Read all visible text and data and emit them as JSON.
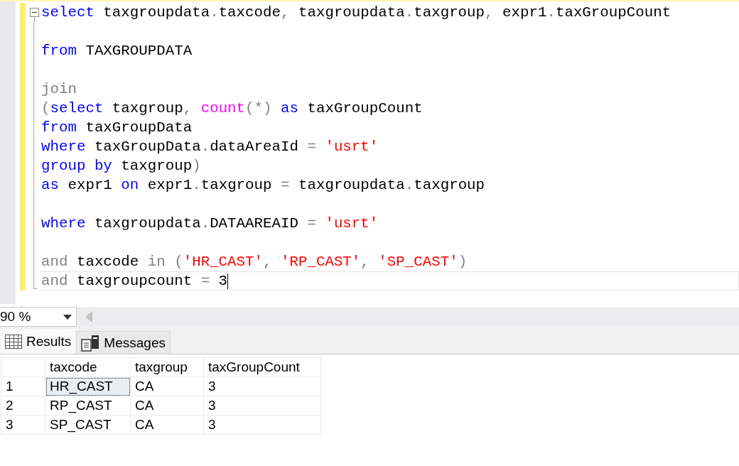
{
  "editor": {
    "lines": [
      {
        "kind": "fold_start",
        "current": false,
        "tokens": [
          {
            "kind": "keyword",
            "text": "select"
          },
          {
            "kind": "plain",
            "text": " taxgroupdata"
          },
          {
            "kind": "operator",
            "text": "."
          },
          {
            "kind": "plain",
            "text": "taxcode"
          },
          {
            "kind": "operator",
            "text": ","
          },
          {
            "kind": "plain",
            "text": " taxgroupdata"
          },
          {
            "kind": "operator",
            "text": "."
          },
          {
            "kind": "plain",
            "text": "taxgroup"
          },
          {
            "kind": "operator",
            "text": ","
          },
          {
            "kind": "plain",
            "text": " expr1"
          },
          {
            "kind": "operator",
            "text": "."
          },
          {
            "kind": "plain",
            "text": "taxGroupCount"
          }
        ]
      },
      {
        "kind": "blank"
      },
      {
        "kind": "code",
        "current": false,
        "tokens": [
          {
            "kind": "keyword",
            "text": "from"
          },
          {
            "kind": "plain",
            "text": " TAXGROUPDATA"
          }
        ]
      },
      {
        "kind": "blank"
      },
      {
        "kind": "code",
        "current": false,
        "tokens": [
          {
            "kind": "operator",
            "text": "join"
          }
        ]
      },
      {
        "kind": "code",
        "current": false,
        "tokens": [
          {
            "kind": "operator",
            "text": "("
          },
          {
            "kind": "keyword",
            "text": "select"
          },
          {
            "kind": "plain",
            "text": " taxgroup"
          },
          {
            "kind": "operator",
            "text": ","
          },
          {
            "kind": "function",
            "text": " count"
          },
          {
            "kind": "operator",
            "text": "(*)"
          },
          {
            "kind": "keyword",
            "text": " as"
          },
          {
            "kind": "plain",
            "text": " taxGroupCount"
          }
        ]
      },
      {
        "kind": "code",
        "current": false,
        "tokens": [
          {
            "kind": "keyword",
            "text": "from"
          },
          {
            "kind": "plain",
            "text": " taxGroupData"
          }
        ]
      },
      {
        "kind": "code",
        "current": false,
        "tokens": [
          {
            "kind": "keyword",
            "text": "where"
          },
          {
            "kind": "plain",
            "text": " taxGroupData"
          },
          {
            "kind": "operator",
            "text": "."
          },
          {
            "kind": "plain",
            "text": "dataAreaId "
          },
          {
            "kind": "operator",
            "text": "="
          },
          {
            "kind": "string",
            "text": " 'usrt'"
          }
        ]
      },
      {
        "kind": "code",
        "current": false,
        "tokens": [
          {
            "kind": "keyword",
            "text": "group by"
          },
          {
            "kind": "plain",
            "text": " taxgroup"
          },
          {
            "kind": "operator",
            "text": ")"
          }
        ]
      },
      {
        "kind": "code",
        "current": false,
        "tokens": [
          {
            "kind": "keyword",
            "text": "as"
          },
          {
            "kind": "plain",
            "text": " expr1 "
          },
          {
            "kind": "keyword",
            "text": "on"
          },
          {
            "kind": "plain",
            "text": " expr1"
          },
          {
            "kind": "operator",
            "text": "."
          },
          {
            "kind": "plain",
            "text": "taxgroup "
          },
          {
            "kind": "operator",
            "text": "="
          },
          {
            "kind": "plain",
            "text": " taxgroupdata"
          },
          {
            "kind": "operator",
            "text": "."
          },
          {
            "kind": "plain",
            "text": "taxgroup"
          }
        ]
      },
      {
        "kind": "blank"
      },
      {
        "kind": "code",
        "current": false,
        "tokens": [
          {
            "kind": "keyword",
            "text": "where"
          },
          {
            "kind": "plain",
            "text": " taxgroupdata"
          },
          {
            "kind": "operator",
            "text": "."
          },
          {
            "kind": "plain",
            "text": "DATAAREAID "
          },
          {
            "kind": "operator",
            "text": "="
          },
          {
            "kind": "string",
            "text": " 'usrt'"
          }
        ]
      },
      {
        "kind": "blank"
      },
      {
        "kind": "code",
        "current": false,
        "tokens": [
          {
            "kind": "operator",
            "text": "and"
          },
          {
            "kind": "plain",
            "text": " taxcode "
          },
          {
            "kind": "operator",
            "text": "in ("
          },
          {
            "kind": "string",
            "text": "'HR_CAST'"
          },
          {
            "kind": "operator",
            "text": ","
          },
          {
            "kind": "string",
            "text": " 'RP_CAST'"
          },
          {
            "kind": "operator",
            "text": ","
          },
          {
            "kind": "string",
            "text": " 'SP_CAST'"
          },
          {
            "kind": "operator",
            "text": ")"
          }
        ]
      },
      {
        "kind": "code",
        "current": true,
        "tokens": [
          {
            "kind": "operator",
            "text": "and"
          },
          {
            "kind": "plain",
            "text": " taxgroupcount "
          },
          {
            "kind": "operator",
            "text": "="
          },
          {
            "kind": "plain",
            "text": " 3"
          }
        ]
      }
    ]
  },
  "zoom": {
    "value": "90 %"
  },
  "tabs": [
    {
      "label": "Results",
      "selected": true
    },
    {
      "label": "Messages",
      "selected": false
    }
  ],
  "results": {
    "columns": [
      "taxcode",
      "taxgroup",
      "taxGroupCount"
    ],
    "rows": [
      {
        "row_number": "1",
        "cells": [
          {
            "text": "HR_CAST",
            "selected": true
          },
          {
            "text": "CA",
            "selected": false
          },
          {
            "text": "3",
            "selected": false
          }
        ]
      },
      {
        "row_number": "2",
        "cells": [
          {
            "text": "RP_CAST",
            "selected": false
          },
          {
            "text": "CA",
            "selected": false
          },
          {
            "text": "3",
            "selected": false
          }
        ]
      },
      {
        "row_number": "3",
        "cells": [
          {
            "text": "SP_CAST",
            "selected": false
          },
          {
            "text": "CA",
            "selected": false
          },
          {
            "text": "3",
            "selected": false
          }
        ]
      }
    ]
  }
}
